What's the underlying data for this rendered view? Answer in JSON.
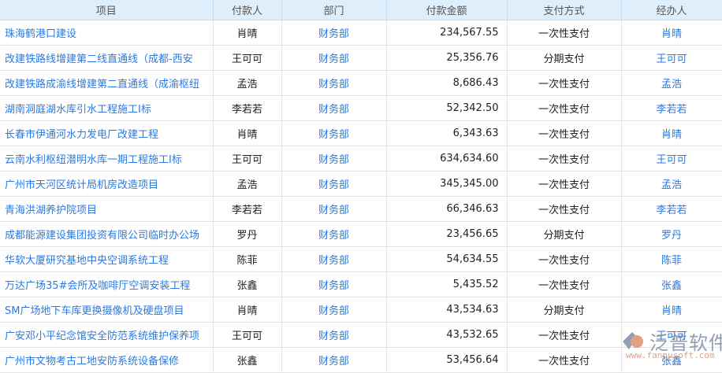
{
  "headers": [
    "项目",
    "付款人",
    "部门",
    "付款金额",
    "支付方式",
    "经办人"
  ],
  "rows": [
    [
      "珠海鹤港口建设",
      "肖晴",
      "财务部",
      "234,567.55",
      "一次性支付",
      "肖晴"
    ],
    [
      "改建铁路线增建第二线直通线（成都-西安",
      "王可可",
      "财务部",
      "25,356.76",
      "分期支付",
      "王可可"
    ],
    [
      "改建铁路成渝线增建第二直通线（成渝枢纽",
      "孟浩",
      "财务部",
      "8,686.43",
      "一次性支付",
      "孟浩"
    ],
    [
      "湖南洞庭湖水库引水工程施工I标",
      "李若若",
      "财务部",
      "52,342.50",
      "一次性支付",
      "李若若"
    ],
    [
      "长春市伊通河水力发电厂改建工程",
      "肖晴",
      "财务部",
      "6,343.63",
      "一次性支付",
      "肖晴"
    ],
    [
      "云南水利枢纽潜明水库一期工程施工I标",
      "王可可",
      "财务部",
      "634,634.60",
      "一次性支付",
      "王可可"
    ],
    [
      "广州市天河区统计局机房改造项目",
      "孟浩",
      "财务部",
      "345,345.00",
      "一次性支付",
      "孟浩"
    ],
    [
      "青海洪湖养护院项目",
      "李若若",
      "财务部",
      "66,346.63",
      "一次性支付",
      "李若若"
    ],
    [
      "成都能源建设集团投资有限公司临时办公场",
      "罗丹",
      "财务部",
      "23,456.65",
      "分期支付",
      "罗丹"
    ],
    [
      "华软大厦研究基地中央空调系统工程",
      "陈菲",
      "财务部",
      "54,634.55",
      "一次性支付",
      "陈菲"
    ],
    [
      "万达广场35#会所及咖啡厅空调安装工程",
      "张鑫",
      "财务部",
      "5,435.52",
      "一次性支付",
      "张鑫"
    ],
    [
      "SM广场地下车库更换摄像机及硬盘项目",
      "肖晴",
      "财务部",
      "43,534.63",
      "分期支付",
      "肖晴"
    ],
    [
      "广安邓小平纪念馆安全防范系统维护保养项",
      "王可可",
      "财务部",
      "43,532.65",
      "一次性支付",
      "王可可"
    ],
    [
      "广州市文物考古工地安防系统设备保修",
      "张鑫",
      "财务部",
      "53,456.64",
      "一次性支付",
      "张鑫"
    ]
  ],
  "watermark": {
    "name": "泛普软件",
    "url": "www.fanpusoft.com"
  }
}
